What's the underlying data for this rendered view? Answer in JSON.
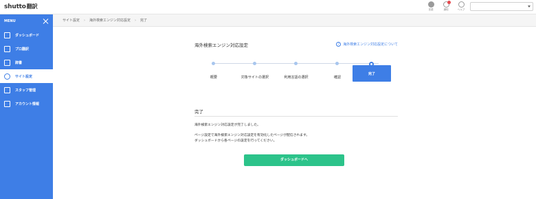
{
  "header": {
    "logo_main": "shutto",
    "logo_sub": "翻訳",
    "icons": [
      {
        "name": "language-icon",
        "label": "言語"
      },
      {
        "name": "notification-icon",
        "label": "通知"
      },
      {
        "name": "help-icon",
        "label": "ヘルプ"
      }
    ],
    "select_value": ""
  },
  "sidebar": {
    "menu_label": "MENU",
    "items": [
      {
        "label": "ダッシュボード",
        "icon": "home-icon"
      },
      {
        "label": "プロ翻訳",
        "icon": "translation-icon"
      },
      {
        "label": "辞書",
        "icon": "dictionary-icon"
      },
      {
        "label": "サイト設定",
        "icon": "gear-icon",
        "active": true
      },
      {
        "label": "スタッフ管理",
        "icon": "staff-icon"
      },
      {
        "label": "アカウント情報",
        "icon": "account-icon"
      }
    ]
  },
  "breadcrumb": [
    "サイト設定",
    "海外検索エンジン対応設定",
    "完了"
  ],
  "panel": {
    "title": "海外検索エンジン対応設定",
    "about_link": "海外検索エンジン対応設定について",
    "steps": [
      "概要",
      "対象サイトの選択",
      "利用言語の選択",
      "確認",
      "完了"
    ],
    "current_step": 4,
    "section_title": "完了",
    "message_1": "海外検索エンジン対応設定が完了しました。",
    "message_2": "ページ設定で海外検索エンジン対応設定を有効化したページが配信されます。",
    "message_3": "ダッシュボードから各ページの設定を行ってください。",
    "cta_label": "ダッシュボードへ"
  },
  "colors": {
    "sidebar": "#3e7ee6",
    "cta": "#2cc38a",
    "step_active": "#3e7ee6"
  }
}
